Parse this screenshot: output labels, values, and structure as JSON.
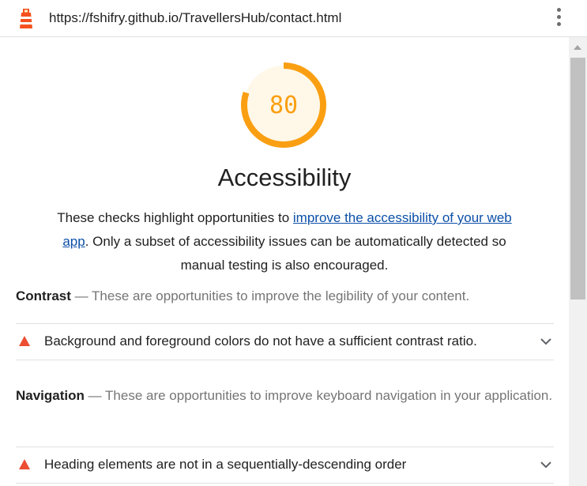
{
  "url_bar": {
    "url": "https://fshifry.github.io/TravellersHub/contact.html",
    "logo_icon": "lighthouse-icon",
    "menu_icon": "kebab-menu-icon"
  },
  "score": {
    "value": "80",
    "fraction": 0.8,
    "color": "#fa9f12"
  },
  "category": {
    "title": "Accessibility",
    "description_before": "These checks highlight opportunities to ",
    "description_link": "improve the accessibility of your web app",
    "description_after": ". Only a subset of accessibility issues can be automatically detected so manual testing is also encouraged."
  },
  "groups": [
    {
      "title": "Contrast",
      "separator": " — ",
      "description": "These are opportunities to improve the legibility of your content.",
      "audit": "Background and foreground colors do not have a sufficient contrast ratio."
    },
    {
      "title": "Navigation",
      "separator": " — ",
      "description": "These are opportunities to improve keyboard navigation in your application.",
      "audit": "Heading elements are not in a sequentially-descending order"
    }
  ],
  "colors": {
    "fail": "#eb4e33",
    "link": "#0b4fa8"
  }
}
